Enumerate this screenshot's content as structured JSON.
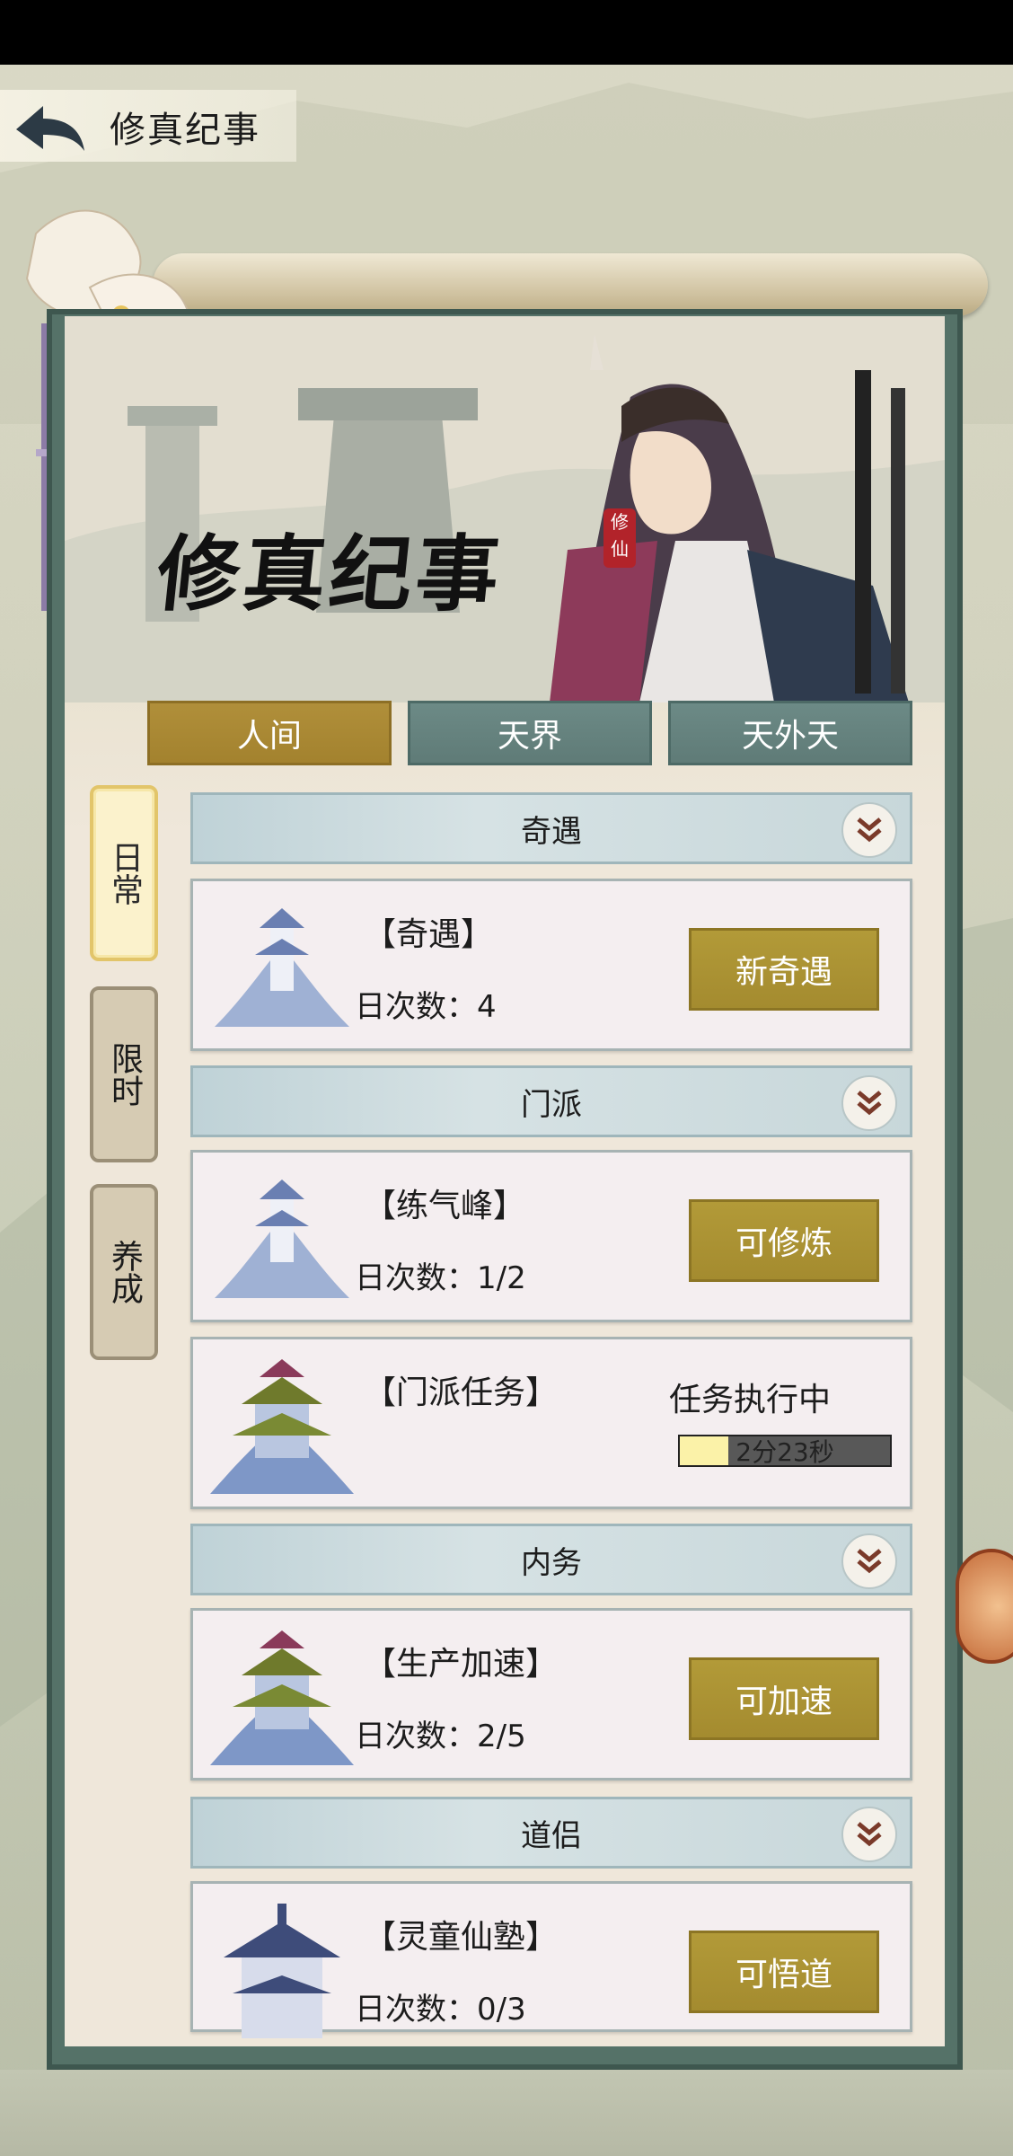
{
  "header": {
    "title": "修真纪事"
  },
  "banner": {
    "title": "修真纪事",
    "seal_text": "修仙"
  },
  "tabs": [
    {
      "label": "人间",
      "active": true
    },
    {
      "label": "天界",
      "active": false
    },
    {
      "label": "天外天",
      "active": false
    }
  ],
  "side_tabs": [
    {
      "label": "日常",
      "active": true
    },
    {
      "label": "限时",
      "active": false
    },
    {
      "label": "养成",
      "active": false
    }
  ],
  "sections": [
    {
      "title": "奇遇",
      "cards": [
        {
          "name": "【奇遇】",
          "count": "日次数：4",
          "action": "新奇遇"
        }
      ]
    },
    {
      "title": "门派",
      "cards": [
        {
          "name": "【练气峰】",
          "count": "日次数：1/2",
          "action": "可修炼"
        },
        {
          "name": "【门派任务】",
          "status": "任务执行中",
          "timer": "2分23秒",
          "progress": 0.23
        }
      ]
    },
    {
      "title": "内务",
      "cards": [
        {
          "name": "【生产加速】",
          "count": "日次数：2/5",
          "action": "可加速"
        }
      ]
    },
    {
      "title": "道侣",
      "cards": [
        {
          "name": "【灵童仙塾】",
          "count": "日次数：0/3",
          "action": "可悟道"
        }
      ]
    }
  ],
  "colors": {
    "gold": "#a48b2f",
    "teal": "#5f7b77",
    "frame": "#557268"
  }
}
